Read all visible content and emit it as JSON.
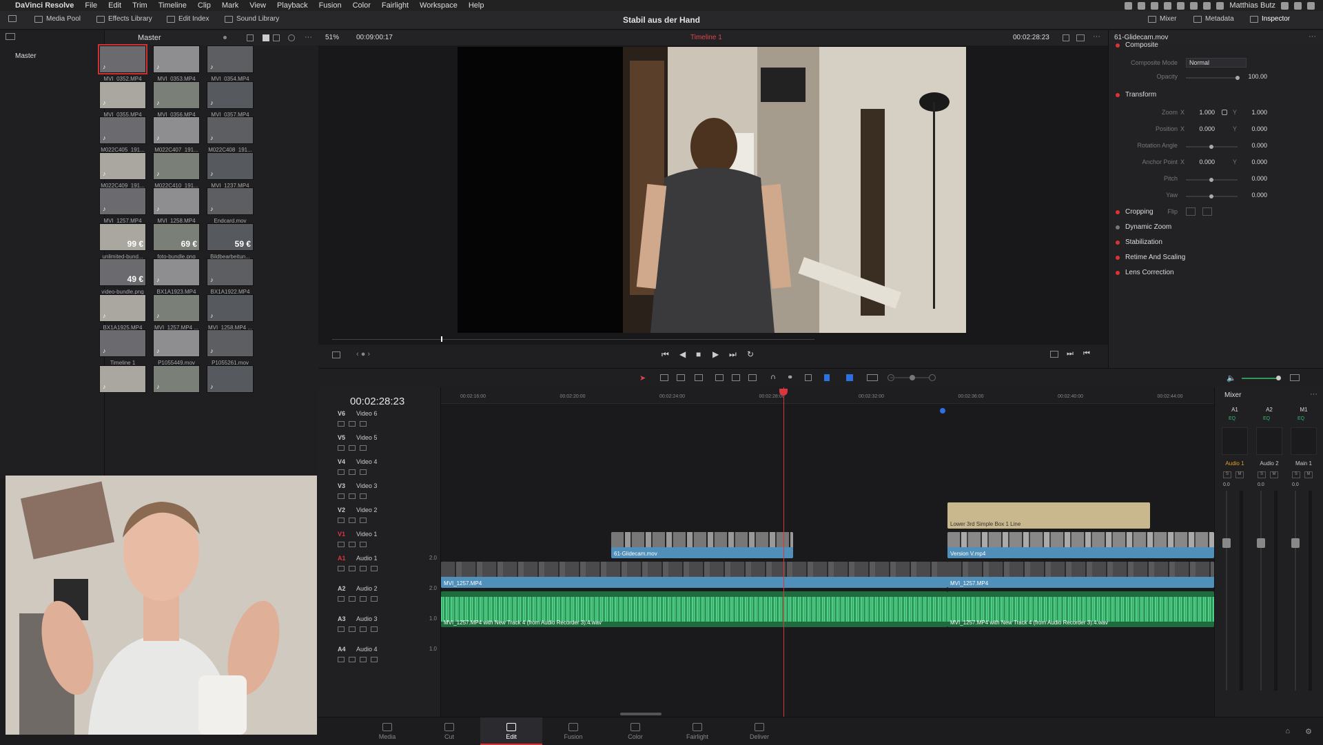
{
  "menubar": {
    "app": "DaVinci Resolve",
    "items": [
      "File",
      "Edit",
      "Trim",
      "Timeline",
      "Clip",
      "Mark",
      "View",
      "Playback",
      "Fusion",
      "Color",
      "Fairlight",
      "Workspace",
      "Help"
    ],
    "user": "Matthias Butz"
  },
  "toolbar": {
    "media_pool": "Media Pool",
    "effects_library": "Effects Library",
    "edit_index": "Edit Index",
    "sound_library": "Sound Library",
    "project_title": "Stabil aus der Hand",
    "mixer": "Mixer",
    "metadata": "Metadata",
    "inspector": "Inspector"
  },
  "sidebar": {
    "master_header": "Master",
    "master_item": "Master"
  },
  "mediapool": {
    "clips": [
      {
        "label": "MVI_0352.MP4",
        "selected": true
      },
      {
        "label": "MVI_0353.MP4"
      },
      {
        "label": "MVI_0354.MP4"
      },
      {
        "label": "MVI_0355.MP4"
      },
      {
        "label": "MVI_0356.MP4"
      },
      {
        "label": "MVI_0357.MP4"
      },
      {
        "label": "M022C405_191..."
      },
      {
        "label": "M022C407_191..."
      },
      {
        "label": "M022C408_191..."
      },
      {
        "label": "M022C409_191..."
      },
      {
        "label": "M022C410_191..."
      },
      {
        "label": "MVI_1237.MP4"
      },
      {
        "label": "MVI_1257.MP4"
      },
      {
        "label": "MVI_1258.MP4"
      },
      {
        "label": "Endcard.mov"
      },
      {
        "label": "unlimited-bund...",
        "price": "99 €"
      },
      {
        "label": "foto-bundle.png",
        "price": "69 €"
      },
      {
        "label": "Bildbearbeitun...",
        "price": "59 €"
      },
      {
        "label": "video-bundle.png",
        "price": "49 €"
      },
      {
        "label": "BX1A1923.MP4"
      },
      {
        "label": "BX1A1922.MP4"
      },
      {
        "label": "BX1A1925.MP4"
      },
      {
        "label": "MVI_1257.MP4 ..."
      },
      {
        "label": "MVI_1258.MP4 ..."
      },
      {
        "label": "Timeline 1"
      },
      {
        "label": "P1055449.mov"
      },
      {
        "label": "P1055261.mov"
      },
      {
        "label": ""
      },
      {
        "label": ""
      },
      {
        "label": ""
      }
    ]
  },
  "viewer": {
    "zoom": "51%",
    "source_tc": "00:09:00:17",
    "timeline_name": "Timeline 1",
    "record_tc": "00:02:28:23"
  },
  "inspector": {
    "clip_name": "61-Glidecam.mov",
    "composite": "Composite",
    "composite_mode_label": "Composite Mode",
    "composite_mode": "Normal",
    "opacity_label": "Opacity",
    "opacity": "100.00",
    "transform": "Transform",
    "zoom_label": "Zoom",
    "zoom_x": "1.000",
    "zoom_y": "1.000",
    "position_label": "Position",
    "position_x": "0.000",
    "position_y": "0.000",
    "rotation_label": "Rotation Angle",
    "rotation": "0.000",
    "anchor_label": "Anchor Point",
    "anchor_x": "0.000",
    "anchor_y": "0.000",
    "pitch_label": "Pitch",
    "pitch": "0.000",
    "yaw_label": "Yaw",
    "yaw": "0.000",
    "flip_label": "Flip",
    "x": "X",
    "y": "Y",
    "cropping": "Cropping",
    "dynamic_zoom": "Dynamic Zoom",
    "stabilization": "Stabilization",
    "retime": "Retime And Scaling",
    "lens": "Lens Correction"
  },
  "timeline": {
    "timecode": "00:02:28:23",
    "ruler": [
      "00:02:16:00",
      "00:02:20:00",
      "00:02:24:00",
      "00:02:28:00",
      "00:02:32:00",
      "00:02:36:00",
      "00:02:40:00",
      "00:02:44:00"
    ],
    "tracks": [
      {
        "id": "V6",
        "name": "Video 6"
      },
      {
        "id": "V5",
        "name": "Video 5"
      },
      {
        "id": "V4",
        "name": "Video 4"
      },
      {
        "id": "V3",
        "name": "Video 3"
      },
      {
        "id": "V2",
        "name": "Video 2"
      },
      {
        "id": "V1",
        "name": "Video 1"
      },
      {
        "id": "A1",
        "name": "Audio 1",
        "level": "2.0"
      },
      {
        "id": "A2",
        "name": "Audio 2",
        "level": "2.0"
      },
      {
        "id": "A3",
        "name": "Audio 3",
        "level": "1.0"
      },
      {
        "id": "A4",
        "name": "Audio 4",
        "level": "1.0"
      }
    ],
    "clips": {
      "title": "Lower 3rd Simple Box 1 Line",
      "v2_a": "61-Glidecam.mov",
      "v2_b": "Version V.mp4",
      "v1_a": "MVI_1257.MP4",
      "v1_b": "MVI_1257.MP4",
      "a1_a": "MVI_1257.MP4 with New Track 4 (from Audio Recorder 3).4.wav",
      "a1_b": "MVI_1257.MP4 with New Track 4 (from Audio Recorder 3).4.wav"
    }
  },
  "mixer": {
    "title": "Mixer",
    "channels": [
      "A1",
      "A2",
      "M1"
    ],
    "eq": "EQ",
    "names": [
      "Audio 1",
      "Audio 2",
      "Main 1"
    ],
    "values": [
      "0.0",
      "0.0",
      "0.0"
    ],
    "scale": [
      "0",
      "-5",
      "-10",
      "-15",
      "-20",
      "-30",
      "-40",
      "-50"
    ]
  },
  "pages": [
    "Media",
    "Cut",
    "Edit",
    "Fusion",
    "Color",
    "Fairlight",
    "Deliver"
  ],
  "colors": {
    "accent": "#d9363e",
    "clip_blue": "#4f8fb9",
    "audio_green": "#2e9a5a",
    "title_tan": "#c9b88d"
  }
}
